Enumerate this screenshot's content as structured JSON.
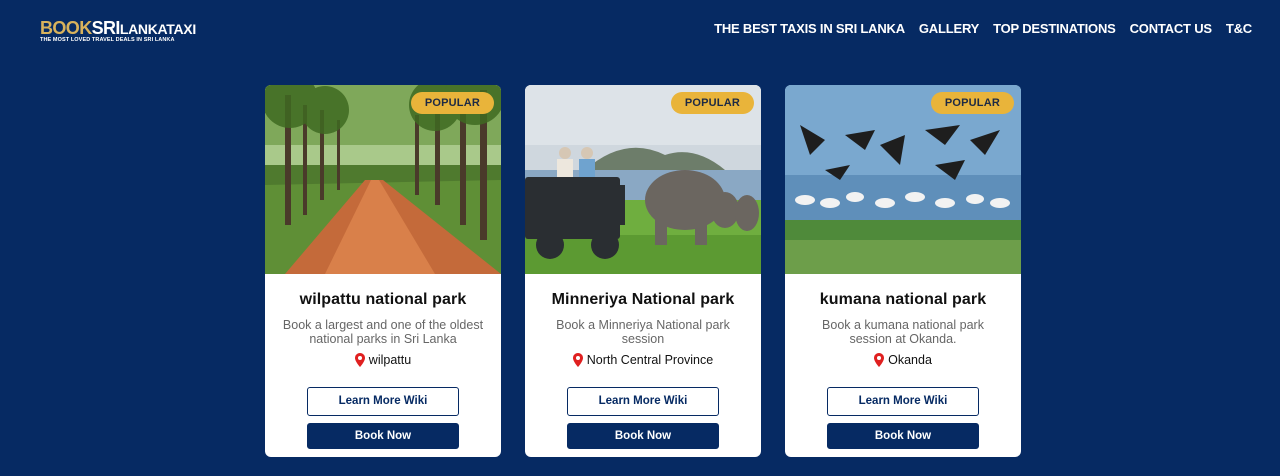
{
  "brand": {
    "book": "BOOK",
    "sri": "SRI",
    "rest": "LANKATAXI",
    "tagline": "THE MOST LOVED TRAVEL DEALS IN SRI LANKA"
  },
  "nav": {
    "items": [
      {
        "label": "THE BEST TAXIS IN SRI LANKA"
      },
      {
        "label": "GALLERY"
      },
      {
        "label": "TOP DESTINATIONS"
      },
      {
        "label": "CONTACT US"
      },
      {
        "label": "T&C"
      }
    ]
  },
  "cards": [
    {
      "badge": "POPULAR",
      "title": "wilpattu national park",
      "description": "Book a largest and one of the oldest national parks in Sri Lanka",
      "location": "wilpattu",
      "more_label": "Learn More Wiki",
      "book_label": "Book Now",
      "image_icon": "forest-road-photo"
    },
    {
      "badge": "POPULAR",
      "title": "Minneriya National park",
      "description": "Book a Minneriya National park session",
      "location": "North Central Province",
      "more_label": "Learn More Wiki",
      "book_label": "Book Now",
      "image_icon": "elephant-safari-photo"
    },
    {
      "badge": "POPULAR",
      "title": "kumana national park",
      "description": "Book a kumana national park session at Okanda.",
      "location": "Okanda",
      "more_label": "Learn More Wiki",
      "book_label": "Book Now",
      "image_icon": "birds-lake-photo"
    }
  ],
  "colors": {
    "background": "#062a63",
    "badge": "#e9b43a",
    "brand_gold": "#d8b25c",
    "pin": "#e02020"
  }
}
